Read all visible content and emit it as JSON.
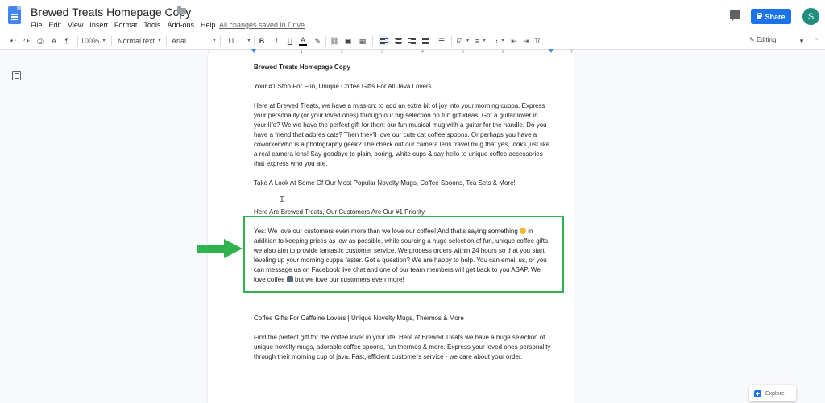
{
  "app": {
    "doc_title": "Brewed Treats Homepage Copy",
    "menu": [
      "File",
      "Edit",
      "View",
      "Insert",
      "Format",
      "Tools",
      "Add-ons",
      "Help"
    ],
    "save_status": "All changes saved in Drive",
    "share_label": "Share",
    "avatar_letter": "S",
    "accent": "#1a73e8"
  },
  "toolbar": {
    "zoom": "100%",
    "style": "Normal text",
    "font": "Arial",
    "size": "11",
    "mode": "Editing"
  },
  "ruler": [
    "1",
    "1",
    "2",
    "3",
    "4",
    "5",
    "6",
    "7"
  ],
  "document": {
    "heading": "Brewed Treats Homepage Copy",
    "tagline": "Your #1 Stop For Fun, Unique Coffee Gifts For All Java Lovers.",
    "intro_1": "Here at Brewed Treats, we have a mission: to add an extra bit of joy into your morning cuppa. Express your personality (or your loved ones) through our big selection on fun gift ideas. Got a guitar lover in your life? We we have the perfect gift for then: our fun musical mug with a guitar for the handle. Do you have a friend that adores cats? Then they'll love our cute cat coffee spoons. Or perhaps you have a coworker",
    "intro_2": "who is a photography geek? The check out our camera lens travel mug that yes, looks just like a real camera lens! Say goodbye to plain, boring, white cups & say hello to unique coffee accessories that express who you are.",
    "popular": "Take A Look At Some Of Our Most Popular Novelty Mugs, Coffee Spoons, Tea Sets & More!",
    "priority": "Here Are Brewed Treats, Our Customers Are Our #1 Priority.",
    "yes_1": "Yes: We love our customers even more than we love our coffee! And that's saying something",
    "yes_2": "in addition to keeping prices as low as possible, while sourcing a huge selection of fun, unique coffee gifts, we also aim to provide fantastic customer service. We process orders within 24 hours so that you start leveling up your morning cuppa faster. Got a question? We are happy to help. You can email us, or you can message us on Facebook live chat and one of our team members will get back to you ASAP. We love coffee",
    "yes_3": "but we love our customers even more!",
    "section_title": "Coffee Gifts For Caffeine Lovers | Unique Novelty Mugs, Thermos & More",
    "find_1": "Find the perfect gift for the coffee lover in your life. Here at Brewed Treats we have a huge selection of unique novelty mugs, adorable coffee spoons, fun thermos & more. Express your loved ones personality through their morning cup of java. Fast, efficient",
    "find_link": "customers",
    "find_2": "service - we care about your order."
  },
  "explore_label": "Explore",
  "colors": {
    "highlight_box": "#2eb34f",
    "arrow": "#2eb34f"
  }
}
